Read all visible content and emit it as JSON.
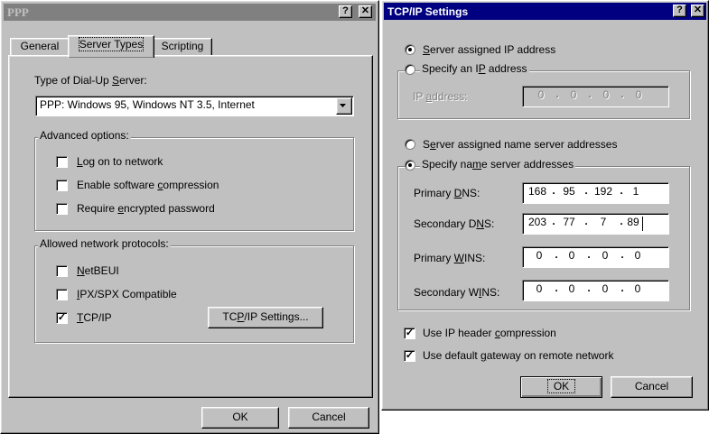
{
  "ppp": {
    "title": "PPP",
    "help_btn": "?",
    "close_btn": "✕",
    "tabs": [
      "General",
      "Server Types",
      "Scripting"
    ],
    "type_label_pre": "Type of Dial-Up ",
    "type_label_ul": "S",
    "type_label_post": "erver:",
    "server_type_value": "PPP: Windows 95, Windows NT 3.5, Internet",
    "advanced_legend": "Advanced options:",
    "opt_logon_ul": "L",
    "opt_logon_rest": "og on to network",
    "opt_compress_pre": "Enable software ",
    "opt_compress_ul": "c",
    "opt_compress_post": "ompression",
    "opt_encrypt_pre": "Require ",
    "opt_encrypt_ul": "e",
    "opt_encrypt_post": "ncrypted password",
    "protocols_legend": "Allowed network protocols:",
    "proto_netbeui_ul": "N",
    "proto_netbeui_rest": "etBEUI",
    "proto_ipx_ul": "I",
    "proto_ipx_rest": "PX/SPX Compatible",
    "proto_tcp_ul": "T",
    "proto_tcp_rest": "CP/IP",
    "tcp_settings_pre": "TC",
    "tcp_settings_ul": "P",
    "tcp_settings_post": "/IP Settings...",
    "checked_mark": "✓",
    "ok": "OK",
    "cancel": "Cancel"
  },
  "tcp": {
    "title": "TCP/IP Settings",
    "help_btn": "?",
    "close_btn": "✕",
    "server_ip_ul": "S",
    "server_ip_rest": "erver assigned IP address",
    "specify_ip_pre": "Specify an I",
    "specify_ip_ul": "P",
    "specify_ip_post": " address",
    "ip_label_pre": "IP ",
    "ip_label_ul": "a",
    "ip_label_post": "ddress:",
    "ip_address": [
      "0",
      "0",
      "0",
      "0"
    ],
    "server_ns_pre": "S",
    "server_ns_ul": "e",
    "server_ns_post": "rver assigned name server addresses",
    "specify_ns_pre": "Specify na",
    "specify_ns_ul": "m",
    "specify_ns_post": "e server addresses",
    "primary_dns_pre": "Primary ",
    "primary_dns_ul": "D",
    "primary_dns_post": "NS:",
    "primary_dns": [
      "168",
      "95",
      "192",
      "1"
    ],
    "secondary_dns_pre": "Secondary D",
    "secondary_dns_ul": "N",
    "secondary_dns_post": "S:",
    "secondary_dns": [
      "203",
      "77",
      "7",
      "89"
    ],
    "primary_wins_pre": "Primary ",
    "primary_wins_ul": "W",
    "primary_wins_post": "INS:",
    "primary_wins": [
      "0",
      "0",
      "0",
      "0"
    ],
    "secondary_wins_pre": "Secondary W",
    "secondary_wins_ul": "I",
    "secondary_wins_post": "NS:",
    "secondary_wins": [
      "0",
      "0",
      "0",
      "0"
    ],
    "ip_header_pre": "Use IP header ",
    "ip_header_ul": "c",
    "ip_header_post": "ompression",
    "gateway_pre": "Use default ",
    "gateway_ul": "g",
    "gateway_post": "ateway on remote network",
    "checked_mark": "✓",
    "ok": "OK",
    "cancel": "Cancel"
  },
  "colors": {
    "active_title": "#000080",
    "inactive_title": "#808080",
    "face": "#c0c0c0"
  }
}
